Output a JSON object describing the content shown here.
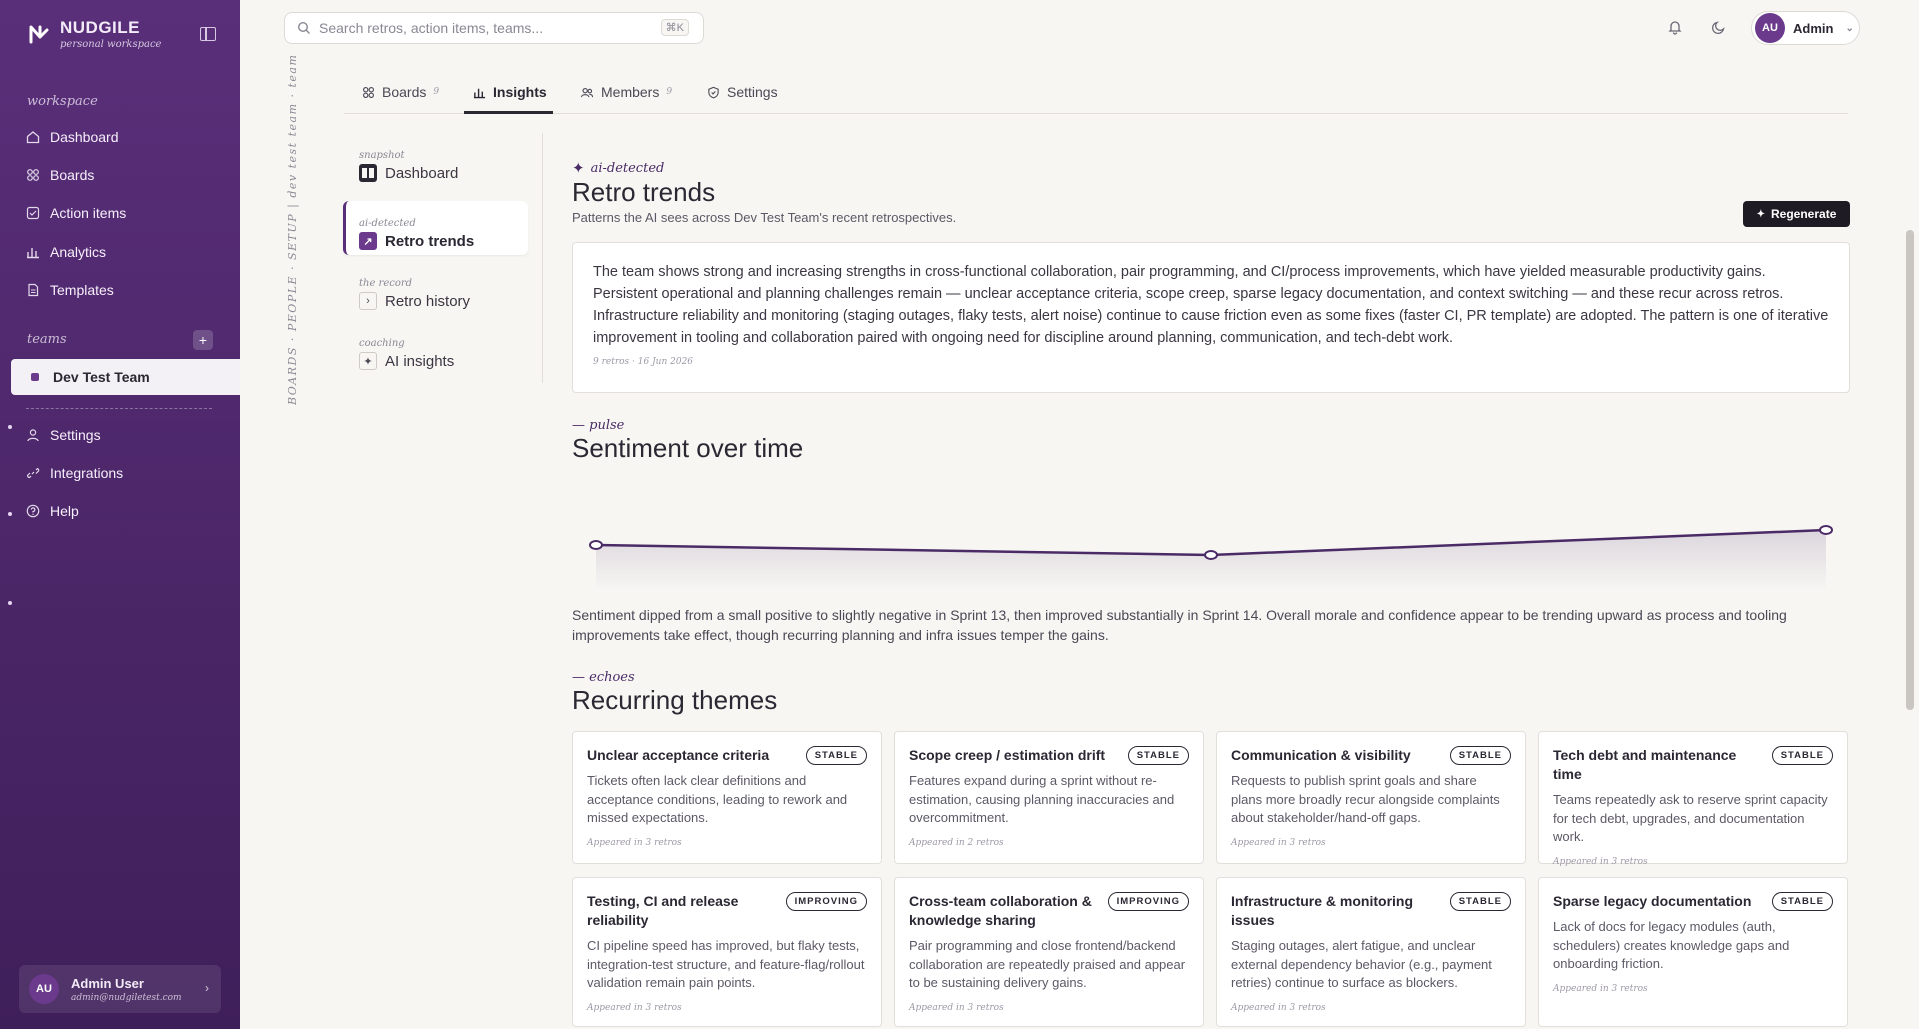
{
  "brand": {
    "name": "NUDGILE",
    "sub": "personal workspace"
  },
  "sidebar": {
    "workspace_label": "workspace",
    "items": [
      {
        "label": "Dashboard",
        "icon": "home-icon"
      },
      {
        "label": "Boards",
        "icon": "grid-icon"
      },
      {
        "label": "Action items",
        "icon": "checklist-icon"
      },
      {
        "label": "Analytics",
        "icon": "bar-chart-icon"
      },
      {
        "label": "Templates",
        "icon": "file-icon"
      }
    ],
    "teams_label": "teams",
    "team": "Dev Test Team",
    "bottom_items": [
      {
        "label": "Settings",
        "icon": "user-icon"
      },
      {
        "label": "Integrations",
        "icon": "link-icon"
      },
      {
        "label": "Help",
        "icon": "help-icon"
      }
    ],
    "user": {
      "initials": "AU",
      "name": "Admin User",
      "email": "admin@nudgiletest.com"
    }
  },
  "topbar": {
    "search_placeholder": "Search retros, action items, teams...",
    "search_shortcut": "⌘K",
    "admin_initials": "AU",
    "admin_label": "Admin"
  },
  "vertical_crumb": "BOARDS · PEOPLE · SETUP | dev test team · team",
  "tabs": [
    {
      "label": "Boards",
      "count": "9"
    },
    {
      "label": "Insights",
      "count": ""
    },
    {
      "label": "Members",
      "count": "9"
    },
    {
      "label": "Settings",
      "count": ""
    }
  ],
  "subnav": [
    {
      "small": "snapshot",
      "label": "Dashboard"
    },
    {
      "small": "ai-detected",
      "label": "Retro trends"
    },
    {
      "small": "the record",
      "label": "Retro history"
    },
    {
      "small": "coaching",
      "label": "AI insights"
    }
  ],
  "trends": {
    "eyebrow": "ai-detected",
    "title": "Retro trends",
    "subtitle": "Patterns the AI sees across Dev Test Team's recent retrospectives.",
    "regenerate": "Regenerate",
    "summary": "The team shows strong and increasing strengths in cross-functional collaboration, pair programming, and CI/process improvements, which have yielded measurable productivity gains. Persistent operational and planning challenges remain — unclear acceptance criteria, scope creep, sparse legacy documentation, and context switching — and these recur across retros. Infrastructure reliability and monitoring (staging outages, flaky tests, alert noise) continue to cause friction even as some fixes (faster CI, PR template) are adopted. The pattern is one of iterative improvement in tooling and collaboration paired with ongoing need for discipline around planning, communication, and tech-debt work.",
    "summary_meta": "9 retros · 16 Jun 2026"
  },
  "sentiment": {
    "eyebrow": "— pulse",
    "title": "Sentiment over time",
    "note": "Sentiment dipped from a small positive to slightly negative in Sprint 13, then improved substantially in Sprint 14. Overall morale and confidence appear to be trending upward as process and tooling improvements take effect, though recurring planning and infra issues temper the gains."
  },
  "chart_data": {
    "type": "line",
    "categories": [
      "",
      "",
      ""
    ],
    "values": [
      0.05,
      -0.05,
      0.2
    ],
    "ylim": [
      -0.4,
      0.6
    ],
    "grid": false,
    "color": "#4a2b66"
  },
  "themes_section": {
    "eyebrow": "— echoes",
    "title": "Recurring themes"
  },
  "themes": [
    {
      "title": "Unclear acceptance criteria",
      "status": "STABLE",
      "desc": "Tickets often lack clear definitions and acceptance conditions, leading to rework and missed expectations.",
      "meta": "Appeared in 3 retros"
    },
    {
      "title": "Scope creep / estimation drift",
      "status": "STABLE",
      "desc": "Features expand during a sprint without re-estimation, causing planning inaccuracies and overcommitment.",
      "meta": "Appeared in 2 retros"
    },
    {
      "title": "Communication & visibility",
      "status": "STABLE",
      "desc": "Requests to publish sprint goals and share plans more broadly recur alongside complaints about stakeholder/hand-off gaps.",
      "meta": "Appeared in 3 retros"
    },
    {
      "title": "Tech debt and maintenance time",
      "status": "STABLE",
      "desc": "Teams repeatedly ask to reserve sprint capacity for tech debt, upgrades, and documentation work.",
      "meta": "Appeared in 3 retros"
    },
    {
      "title": "Testing, CI and release reliability",
      "status": "IMPROVING",
      "desc": "CI pipeline speed has improved, but flaky tests, integration-test structure, and feature-flag/rollout validation remain pain points.",
      "meta": "Appeared in 3 retros"
    },
    {
      "title": "Cross-team collaboration & knowledge sharing",
      "status": "IMPROVING",
      "desc": "Pair programming and close frontend/backend collaboration are repeatedly praised and appear to be sustaining delivery gains.",
      "meta": "Appeared in 3 retros"
    },
    {
      "title": "Infrastructure & monitoring issues",
      "status": "STABLE",
      "desc": "Staging outages, alert fatigue, and unclear external dependency behavior (e.g., payment retries) continue to surface as blockers.",
      "meta": "Appeared in 3 retros"
    },
    {
      "title": "Sparse legacy documentation",
      "status": "STABLE",
      "desc": "Lack of docs for legacy modules (auth, schedulers) creates knowledge gaps and onboarding friction.",
      "meta": "Appeared in 3 retros"
    }
  ]
}
